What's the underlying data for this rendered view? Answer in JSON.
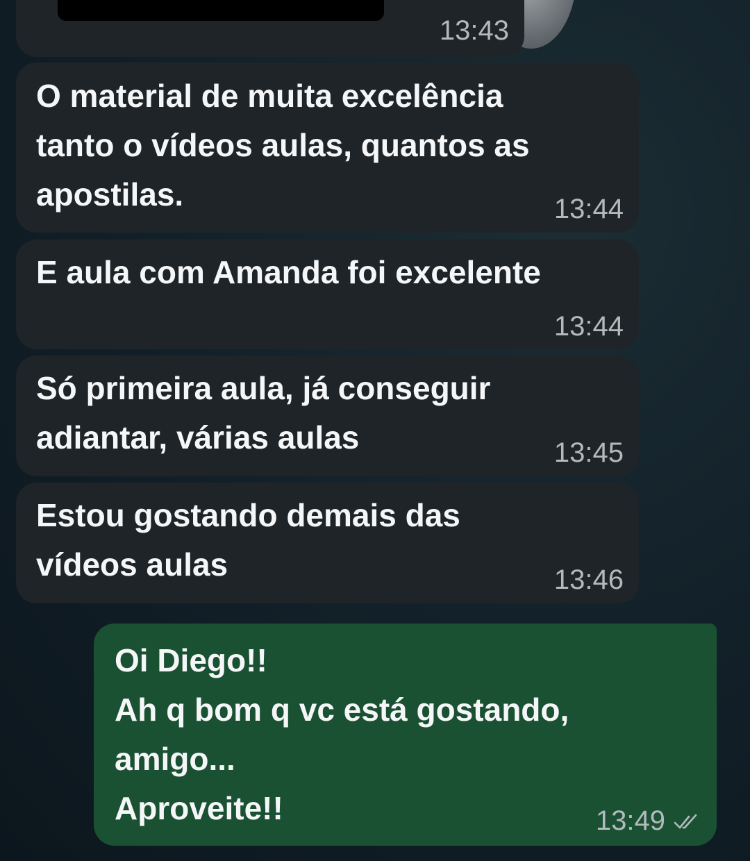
{
  "messages": [
    {
      "direction": "in",
      "text": "",
      "time": "13:43",
      "redacted": true
    },
    {
      "direction": "in",
      "text": "O material de muita excelência\ntanto o vídeos aulas, quantos as\napostilas.",
      "time": "13:44"
    },
    {
      "direction": "in",
      "text": "E aula com Amanda foi excelente",
      "time": "13:44"
    },
    {
      "direction": "in",
      "text": "Só primeira aula, já conseguir\nadiantar, várias aulas",
      "time": "13:45"
    },
    {
      "direction": "in",
      "text": "Estou gostando demais das\nvídeos aulas",
      "time": "13:46"
    },
    {
      "direction": "out",
      "text": "Oi Diego!!\nAh q bom q vc está gostando,\namigo...\nAproveite!!",
      "time": "13:49",
      "status": "read-double-check"
    }
  ],
  "colors": {
    "incoming_bubble": "#1f2428",
    "outgoing_bubble": "#1b5133",
    "timestamp": "#b3babe",
    "read_check": "#b3babe"
  },
  "icons": {
    "read_receipt": "double-check-icon"
  }
}
